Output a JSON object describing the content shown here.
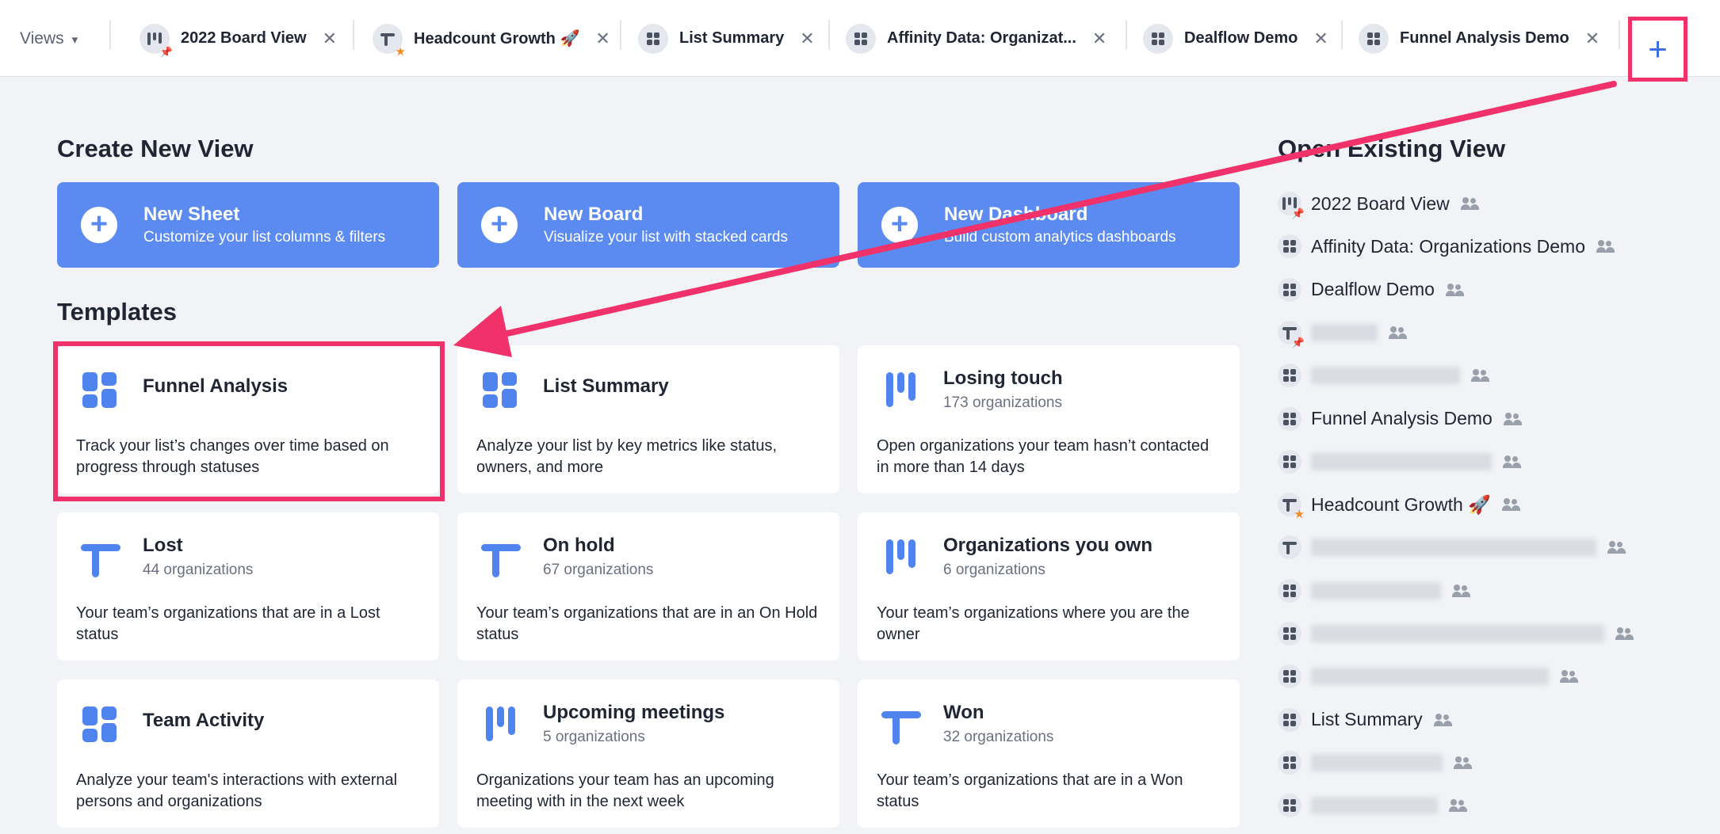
{
  "topbar": {
    "views_label": "Views",
    "tabs": [
      {
        "label": "2022 Board View",
        "icon": "board-icon"
      },
      {
        "label": "Headcount Growth 🚀",
        "icon": "sheet-icon"
      },
      {
        "label": "List Summary",
        "icon": "dashboard-icon"
      },
      {
        "label": "Affinity Data: Organizat...",
        "icon": "dashboard-icon"
      },
      {
        "label": "Dealflow Demo",
        "icon": "dashboard-icon"
      },
      {
        "label": "Funnel Analysis Demo",
        "icon": "dashboard-icon"
      }
    ],
    "close_glyph": "✕",
    "add_glyph": "+"
  },
  "create": {
    "heading": "Create New View",
    "cards": [
      {
        "title": "New Sheet",
        "subtitle": "Customize your list columns & filters"
      },
      {
        "title": "New Board",
        "subtitle": "Visualize your list with stacked cards"
      },
      {
        "title": "New Dashboard",
        "subtitle": "Build custom analytics dashboards"
      }
    ]
  },
  "templates": {
    "heading": "Templates",
    "cards": [
      {
        "title": "Funnel Analysis",
        "count": "",
        "desc": "Track your list’s changes over time based on progress through statuses",
        "icon": "dashboard-icon"
      },
      {
        "title": "List Summary",
        "count": "",
        "desc": "Analyze your list by key metrics like status, owners, and more",
        "icon": "dashboard-icon"
      },
      {
        "title": "Losing touch",
        "count": "173 organizations",
        "desc": "Open organizations your team hasn’t contacted in more than 14 days",
        "icon": "board-icon"
      },
      {
        "title": "Lost",
        "count": "44 organizations",
        "desc": "Your team’s organizations that are in a Lost status",
        "icon": "sheet-icon"
      },
      {
        "title": "On hold",
        "count": "67 organizations",
        "desc": "Your team’s organizations that are in an On Hold status",
        "icon": "sheet-icon"
      },
      {
        "title": "Organizations you own",
        "count": "6 organizations",
        "desc": "Your team’s organizations where you are the owner",
        "icon": "board-icon"
      },
      {
        "title": "Team Activity",
        "count": "",
        "desc": "Analyze your team's interactions with external persons and organizations",
        "icon": "dashboard-icon"
      },
      {
        "title": "Upcoming meetings",
        "count": "5 organizations",
        "desc": "Organizations your team has an upcoming meeting with in the next week",
        "icon": "board-icon"
      },
      {
        "title": "Won",
        "count": "32 organizations",
        "desc": "Your team’s organizations that are in a Won status",
        "icon": "sheet-icon"
      }
    ]
  },
  "existing": {
    "heading": "Open Existing View",
    "items": [
      {
        "label": "2022 Board View",
        "icon": "board-icon",
        "badge": "pin"
      },
      {
        "label": "Affinity Data: Organizations Demo",
        "icon": "dashboard-icon",
        "badge": ""
      },
      {
        "label": "Dealflow Demo",
        "icon": "dashboard-icon",
        "badge": ""
      },
      {
        "label": "",
        "icon": "sheet-icon",
        "badge": "pin"
      },
      {
        "label": "",
        "icon": "dashboard-icon",
        "badge": ""
      },
      {
        "label": "Funnel Analysis Demo",
        "icon": "dashboard-icon",
        "badge": ""
      },
      {
        "label": "",
        "icon": "dashboard-icon",
        "badge": ""
      },
      {
        "label": "Headcount Growth 🚀",
        "icon": "sheet-icon",
        "badge": "star"
      },
      {
        "label": "",
        "icon": "sheet-icon",
        "badge": ""
      },
      {
        "label": "",
        "icon": "dashboard-icon",
        "badge": ""
      },
      {
        "label": "",
        "icon": "dashboard-icon",
        "badge": ""
      },
      {
        "label": "",
        "icon": "dashboard-icon",
        "badge": ""
      },
      {
        "label": "List Summary",
        "icon": "dashboard-icon",
        "badge": ""
      },
      {
        "label": "",
        "icon": "dashboard-icon",
        "badge": ""
      },
      {
        "label": "",
        "icon": "dashboard-icon",
        "badge": ""
      }
    ]
  },
  "colors": {
    "accent": "#5b8bf0",
    "highlight": "#f0316a",
    "badge": "#f08a24"
  }
}
